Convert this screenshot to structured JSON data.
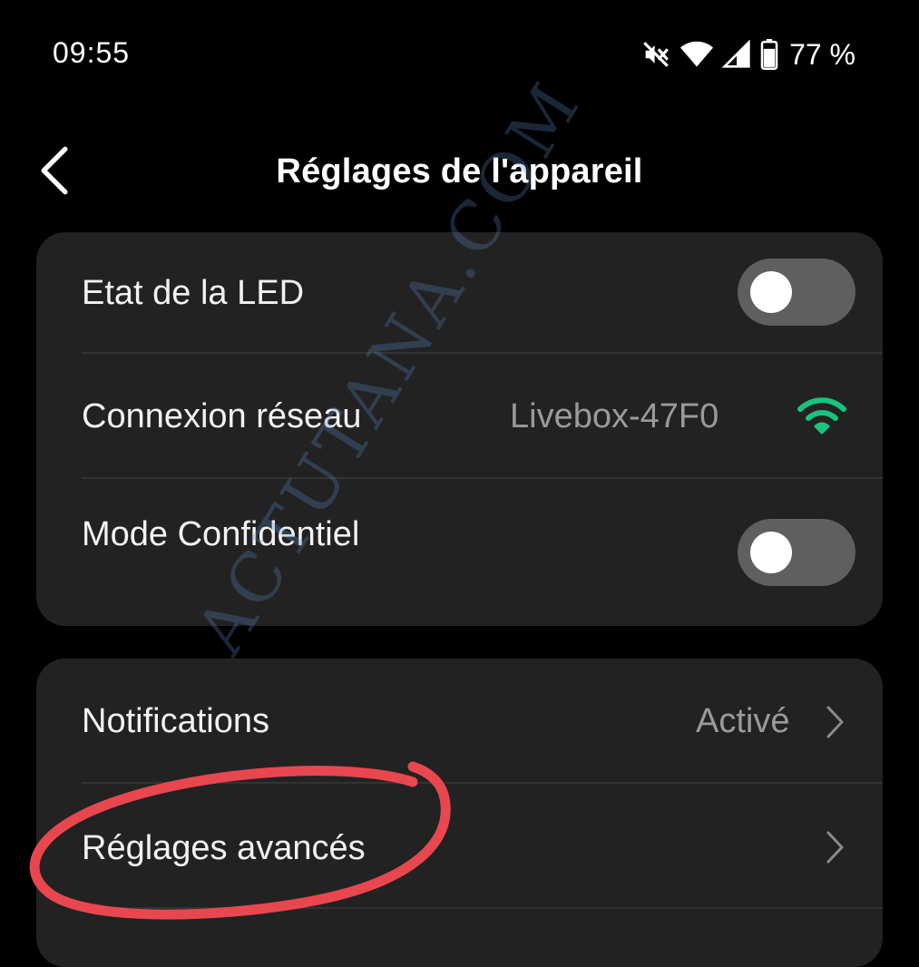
{
  "status_bar": {
    "time": "09:55",
    "battery_text": "77 %",
    "icons": [
      "mute-icon",
      "wifi-icon",
      "signal-icon",
      "battery-icon"
    ]
  },
  "header": {
    "title": "Réglages de l'appareil",
    "back_icon": "chevron-left-icon"
  },
  "card1": {
    "led_label": "Etat de la LED",
    "led_toggle_on": false,
    "network_label": "Connexion réseau",
    "network_value": "Livebox-47F0",
    "network_icon": "wifi-icon",
    "network_icon_color": "#19c37d",
    "private_label": "Mode Confidentiel",
    "private_toggle_on": false
  },
  "card2": {
    "notifications_label": "Notifications",
    "notifications_value": "Activé",
    "advanced_label": "Réglages avancés"
  },
  "watermark": "ACTUTANA.COM",
  "colors": {
    "background": "#000000",
    "card": "#222222",
    "annotation": "#e8474f",
    "secondary_text": "#9a9a9a"
  }
}
